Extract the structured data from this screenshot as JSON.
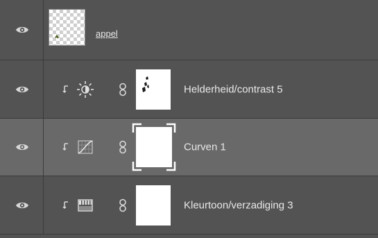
{
  "layers": [
    {
      "name": "appel",
      "type": "pixel",
      "visible_icon": "eye-icon"
    },
    {
      "name": "Helderheid/contrast 5",
      "type": "brightness-contrast",
      "adjust_icon": "brightness-contrast-icon",
      "clip_icon": "clip-arrow-icon",
      "link_icon": "chain-link-icon"
    },
    {
      "name": "Curven 1",
      "type": "curves",
      "adjust_icon": "curves-icon",
      "selected": true,
      "clip_icon": "clip-arrow-icon",
      "link_icon": "chain-link-icon"
    },
    {
      "name": "Kleurtoon/verzadiging 3",
      "type": "hue-saturation",
      "adjust_icon": "hue-saturation-icon",
      "clip_icon": "clip-arrow-icon",
      "link_icon": "chain-link-icon"
    }
  ],
  "colors": {
    "panel_bg": "#535353",
    "selected_bg": "#696969",
    "text": "#e8e8e8"
  }
}
